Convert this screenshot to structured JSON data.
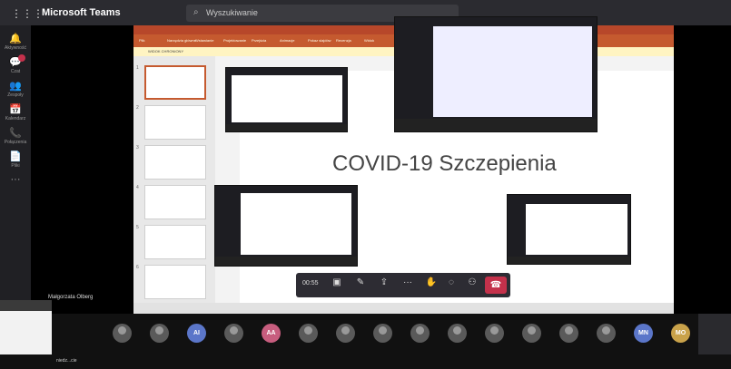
{
  "teams": {
    "app_name": "Microsoft Teams",
    "waffle_icon": "⋮⋮⋮",
    "search_placeholder": "Wyszukiwanie"
  },
  "rail": [
    {
      "icon": "bell-icon",
      "glyph": "🔔",
      "label": "Aktywność"
    },
    {
      "icon": "chat-icon",
      "glyph": "💬",
      "label": "Czat"
    },
    {
      "icon": "teams-icon",
      "glyph": "👥",
      "label": "Zespoły"
    },
    {
      "icon": "calendar-icon",
      "glyph": "📅",
      "label": "Kalendarz"
    },
    {
      "icon": "calls-icon",
      "glyph": "📞",
      "label": "Połączenia"
    },
    {
      "icon": "files-icon",
      "glyph": "📄",
      "label": "Pliki"
    },
    {
      "icon": "more-icon",
      "glyph": "···",
      "label": ""
    }
  ],
  "presentation": {
    "slide_title": "COVID-19 Szczepienia",
    "ribbon_tabs": [
      "Plik",
      "Narzędzia główne",
      "Wstawianie",
      "Projektowanie",
      "Przejścia",
      "Animacje",
      "Pokaz slajdów",
      "Recenzja",
      "Widok"
    ],
    "warning": "WIDOK CHRONIONY",
    "thumb_numbers": [
      "1",
      "2",
      "3",
      "4",
      "5",
      "6"
    ]
  },
  "controls": {
    "timer": "00:55",
    "icons": [
      "camera-icon",
      "mic-icon",
      "share-icon",
      "more-icon",
      "hand-icon",
      "chat-icon",
      "participants-icon"
    ]
  },
  "presenter_name": "Małgorzata Olberg",
  "participants": [
    {
      "type": "photo"
    },
    {
      "type": "photo"
    },
    {
      "type": "initials",
      "text": "AI",
      "color": "#5b76c9"
    },
    {
      "type": "photo"
    },
    {
      "type": "initials",
      "text": "AA",
      "color": "#c75d7e"
    },
    {
      "type": "photo"
    },
    {
      "type": "photo"
    },
    {
      "type": "photo"
    },
    {
      "type": "photo"
    },
    {
      "type": "photo"
    },
    {
      "type": "photo"
    },
    {
      "type": "photo"
    },
    {
      "type": "photo"
    },
    {
      "type": "photo"
    },
    {
      "type": "initials",
      "text": "MN",
      "color": "#5b76c9"
    },
    {
      "type": "initials",
      "text": "MO",
      "color": "#c9a24a"
    }
  ],
  "taskbar": {
    "label": "niedz...cie"
  },
  "colors": {
    "leave": "#c4314b",
    "ppt": "#b7472a"
  }
}
